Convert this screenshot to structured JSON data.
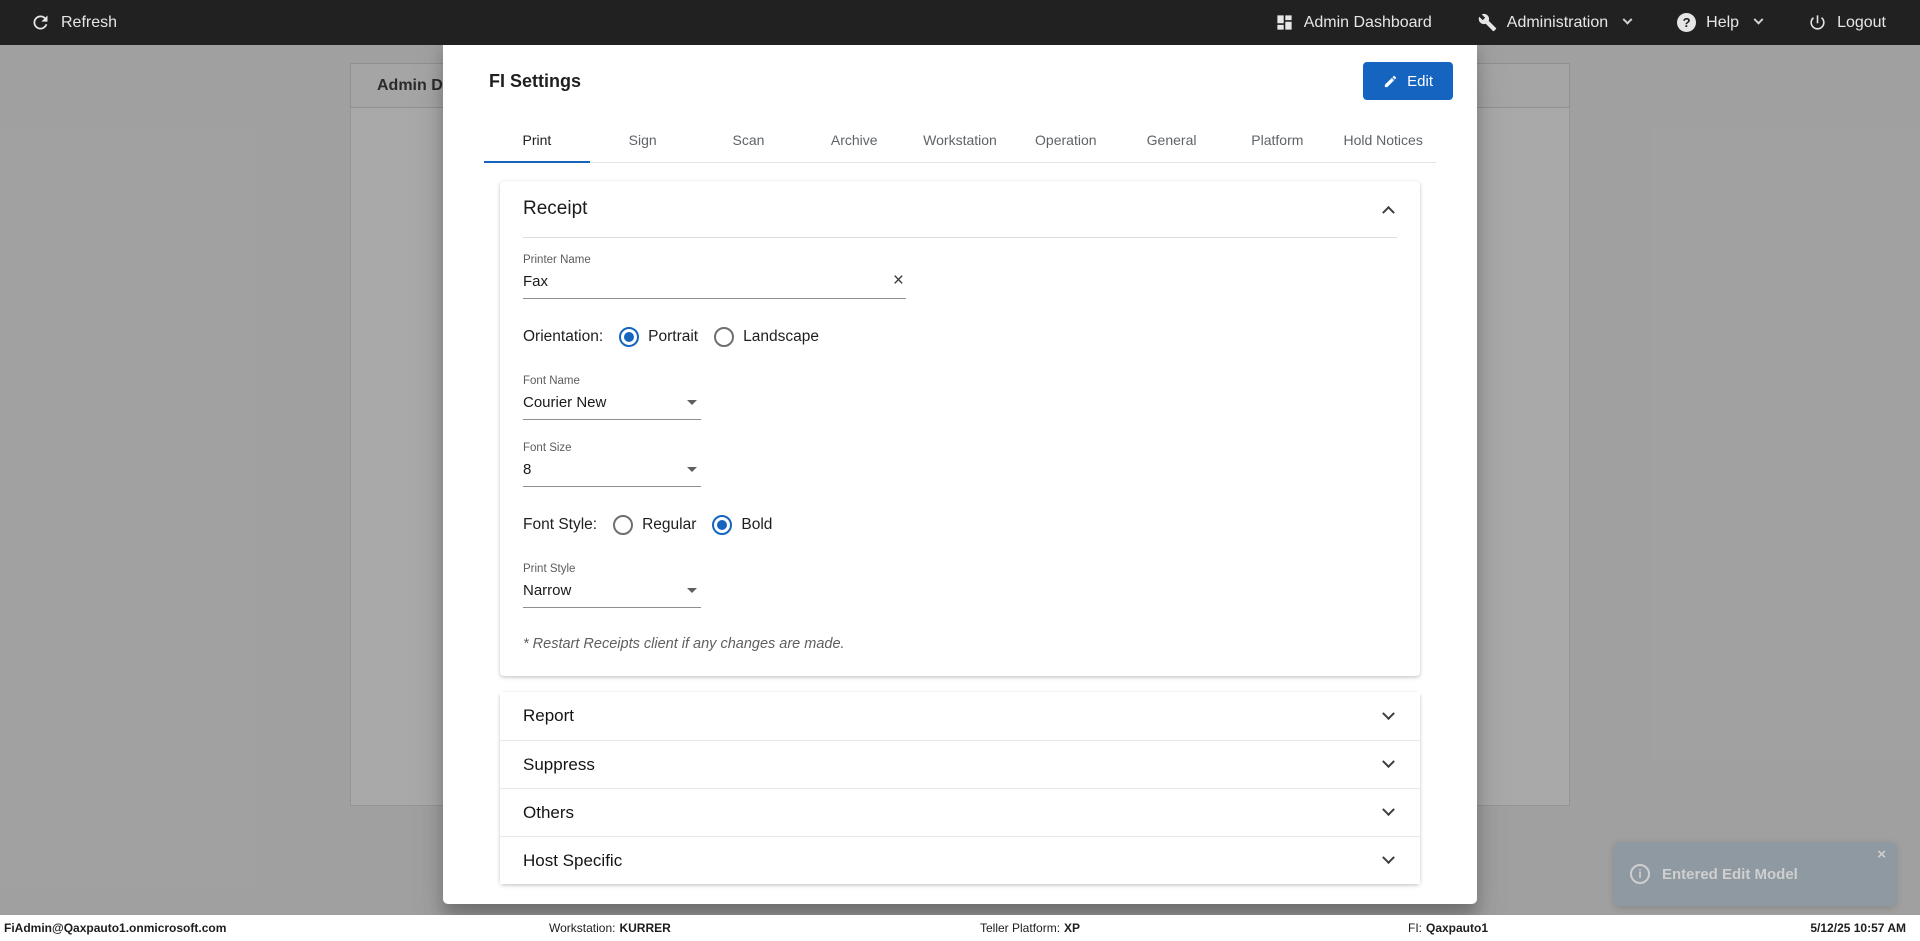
{
  "colors": {
    "accent": "#1565c0",
    "topbar_bg": "#212121",
    "toast_bg": "#78909c"
  },
  "topbar": {
    "refresh": "Refresh",
    "admin_dashboard": "Admin Dashboard",
    "administration": "Administration",
    "help": "Help",
    "logout": "Logout"
  },
  "background_panel": {
    "title": "Admin D"
  },
  "modal": {
    "title": "FI Settings",
    "edit_button_label": "Edit",
    "tabs": [
      {
        "label": "Print",
        "active": true
      },
      {
        "label": "Sign"
      },
      {
        "label": "Scan"
      },
      {
        "label": "Archive"
      },
      {
        "label": "Workstation"
      },
      {
        "label": "Operation"
      },
      {
        "label": "General"
      },
      {
        "label": "Platform"
      },
      {
        "label": "Hold Notices"
      }
    ],
    "receipt": {
      "title": "Receipt",
      "printer_name": {
        "label": "Printer Name",
        "value": "Fax"
      },
      "orientation": {
        "label": "Orientation:",
        "options": [
          "Portrait",
          "Landscape"
        ],
        "selected": "Portrait"
      },
      "font_name": {
        "label": "Font Name",
        "value": "Courier New"
      },
      "font_size": {
        "label": "Font Size",
        "value": "8"
      },
      "font_style": {
        "label": "Font Style:",
        "options": [
          "Regular",
          "Bold"
        ],
        "selected": "Bold"
      },
      "print_style": {
        "label": "Print Style",
        "value": "Narrow"
      },
      "note": "* Restart Receipts client if any changes are made."
    },
    "sections": [
      {
        "title": "Report"
      },
      {
        "title": "Suppress"
      },
      {
        "title": "Others"
      },
      {
        "title": "Host Specific"
      }
    ]
  },
  "statusbar": {
    "user": "FiAdmin@Qaxpauto1.onmicrosoft.com",
    "workstation_label": "Workstation:",
    "workstation_value": "KURRER",
    "teller_platform_label": "Teller Platform:",
    "teller_platform_value": "XP",
    "fi_label": "FI:",
    "fi_value": "Qaxpauto1",
    "datetime": "5/12/25 10:57 AM"
  },
  "toast": {
    "message": "Entered Edit Model"
  }
}
